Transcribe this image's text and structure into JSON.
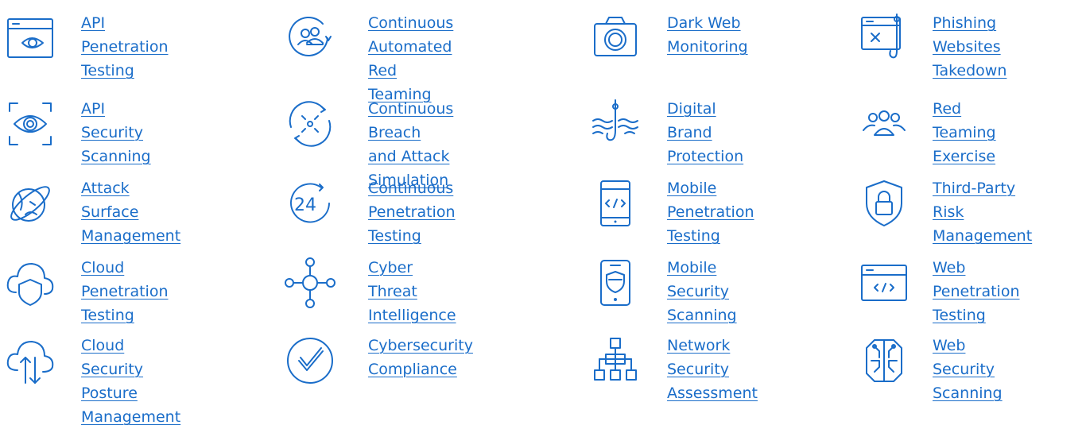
{
  "services": [
    {
      "id": "api-penetration-testing",
      "label": "API Penetration\nTesting",
      "icon": "browser-eye-icon"
    },
    {
      "id": "continuous-automated-red-teaming",
      "label": "Continuous Automated\nRed Teaming",
      "icon": "team-cycle-icon"
    },
    {
      "id": "dark-web-monitoring",
      "label": "Dark Web\nMonitoring",
      "icon": "camera-icon"
    },
    {
      "id": "phishing-websites-takedown",
      "label": "Phishing\nWebsites\nTakedown",
      "icon": "browser-hook-icon"
    },
    {
      "id": "api-security-scanning",
      "label": "API Security\nScanning",
      "icon": "scan-eye-icon"
    },
    {
      "id": "continuous-breach-and-attack-simulation",
      "label": "Continuous Breach\nand Attack Simulation",
      "icon": "cycle-arrows-icon"
    },
    {
      "id": "digital-brand-protection",
      "label": "Digital Brand\nProtection",
      "icon": "fishing-hook-icon"
    },
    {
      "id": "red-teaming-exercise",
      "label": "Red Teaming\nExercise",
      "icon": "group-users-icon"
    },
    {
      "id": "attack-surface-management",
      "label": "Attack Surface\nManagement",
      "icon": "globe-orbit-icon"
    },
    {
      "id": "continuous-penetration-testing",
      "label": "Continuous\nPenetration Testing",
      "icon": "clock-24-icon"
    },
    {
      "id": "mobile-penetration-testing",
      "label": "Mobile Penetration\nTesting",
      "icon": "phone-code-icon"
    },
    {
      "id": "third-party-risk-management",
      "label": "Third-Party Risk\nManagement",
      "icon": "shield-lock-icon"
    },
    {
      "id": "cloud-penetration-testing",
      "label": "Cloud Penetration\nTesting",
      "icon": "cloud-shield-icon"
    },
    {
      "id": "cyber-threat-intelligence",
      "label": "Cyber Threat\nIntelligence",
      "icon": "network-hub-icon"
    },
    {
      "id": "mobile-security-scanning",
      "label": "Mobile Security\nScanning",
      "icon": "phone-shield-icon"
    },
    {
      "id": "web-penetration-testing",
      "label": "Web Penetration\nTesting",
      "icon": "browser-code-icon"
    },
    {
      "id": "cloud-security-posture-management",
      "label": "Cloud Security Posture\nManagement",
      "icon": "cloud-arrows-icon"
    },
    {
      "id": "cybersecurity-compliance",
      "label": "Cybersecurity\nCompliance",
      "icon": "check-circle-icon"
    },
    {
      "id": "network-security-assessment",
      "label": "Network Security\nAssessment",
      "icon": "network-tree-icon"
    },
    {
      "id": "web-security-scanning",
      "label": "Web Security\nScanning",
      "icon": "chip-circuit-icon"
    }
  ],
  "colors": {
    "link": "#1a6dc9",
    "icon": "#1a6dc9"
  }
}
